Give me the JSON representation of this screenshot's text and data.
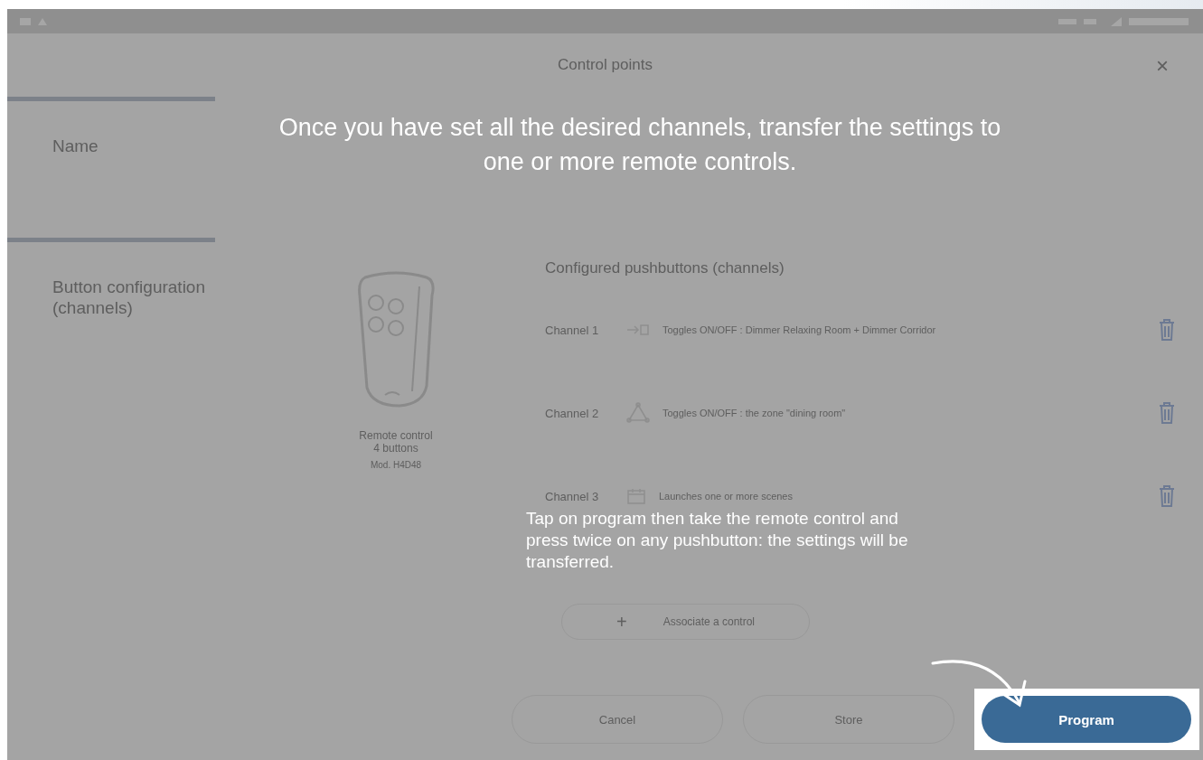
{
  "dialog": {
    "title": "Control points",
    "close": "×"
  },
  "sidebar": {
    "items": [
      {
        "label": "Name",
        "selected": false
      },
      {
        "label": "Button configuration (channels)",
        "selected": false
      }
    ]
  },
  "device": {
    "name": "Remote control 4 buttons",
    "model": "Mod. H4D48"
  },
  "channels": {
    "heading": "Configured pushbuttons (channels)",
    "rows": [
      {
        "label": "Channel 1",
        "kind": "scene",
        "description": "Toggles ON/OFF : Dimmer Relaxing Room + Dimmer Corridor"
      },
      {
        "label": "Channel 2",
        "kind": "zone",
        "description": "Toggles ON/OFF : the zone \"dining room\""
      },
      {
        "label": "Channel 3",
        "kind": "calendar",
        "description": "Launches one or more scenes"
      }
    ]
  },
  "associate_button": {
    "icon": "+",
    "label": "Associate a control"
  },
  "buttons": [
    {
      "label": "Cancel",
      "highlighted": false
    },
    {
      "label": "Store",
      "highlighted": false
    },
    {
      "label": "Program",
      "highlighted": true
    }
  ],
  "overlay": {
    "headline": "Once you have set all the desired channels, transfer the settings to one or more remote controls.",
    "hint": "Tap on program then take the remote control and press twice on any pushbutton: the settings will be transferred."
  }
}
